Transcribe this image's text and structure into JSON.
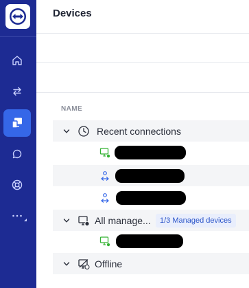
{
  "page": {
    "title": "Devices"
  },
  "nav": {
    "items": [
      {
        "icon": "home-icon"
      },
      {
        "icon": "transfer-arrows-icon"
      },
      {
        "icon": "devices-icon",
        "active": true
      },
      {
        "icon": "chat-icon"
      },
      {
        "icon": "support-lifebuoy-icon"
      },
      {
        "icon": "more-dots-icon"
      }
    ]
  },
  "list": {
    "column_header": "NAME",
    "groups": [
      {
        "label": "Recent connections",
        "icon": "clock-icon",
        "expanded": true,
        "devices": [
          {
            "icon": "monitor-online-icon"
          },
          {
            "icon": "remote-session-icon"
          },
          {
            "icon": "remote-session-icon"
          }
        ]
      },
      {
        "label": "All manage...",
        "icon": "managed-monitor-icon",
        "expanded": true,
        "badge": "1/3 Managed devices",
        "devices": [
          {
            "icon": "monitor-online-icon"
          }
        ]
      },
      {
        "label": "Offline",
        "icon": "offline-monitor-icon",
        "expanded": true,
        "devices": []
      }
    ]
  },
  "colors": {
    "rail": "#1d2b93",
    "rail_active": "#3567e8",
    "badge_bg": "#e9eefc",
    "badge_text": "#2b55c9",
    "online": "#34b233"
  }
}
